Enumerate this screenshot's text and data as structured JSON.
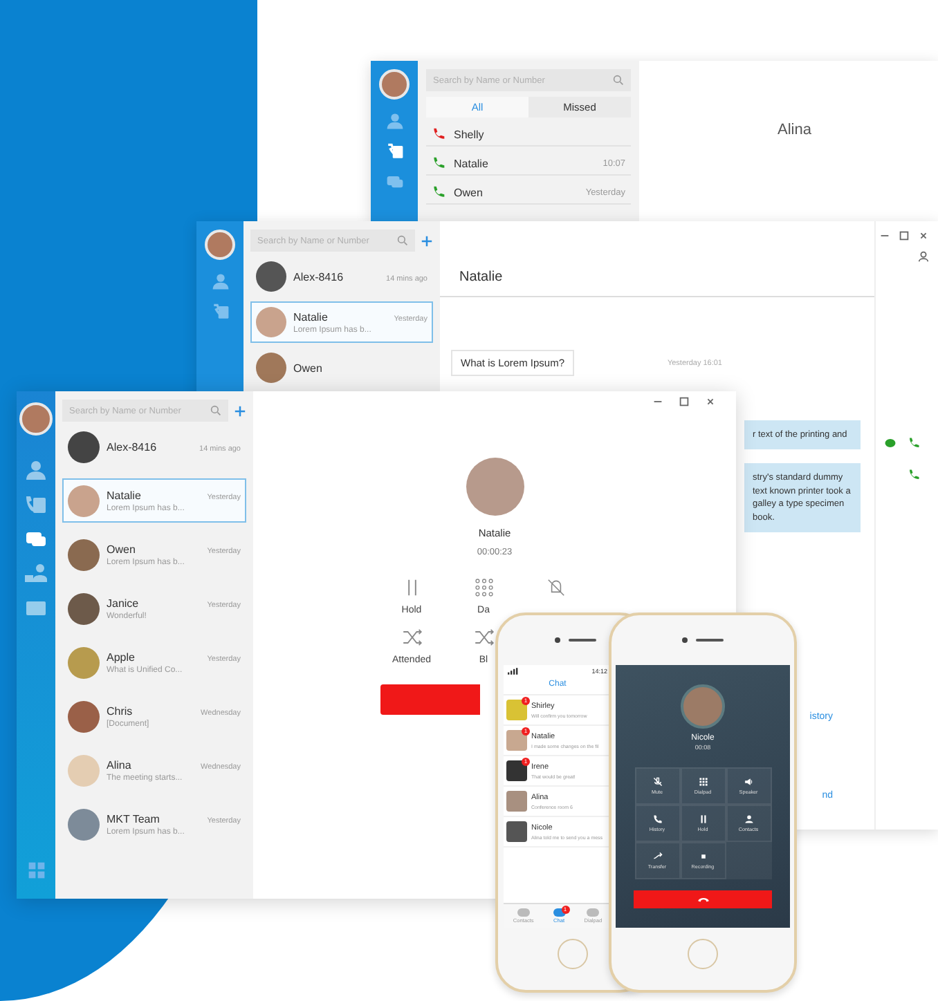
{
  "calls_window": {
    "title": "Alina",
    "search": {
      "placeholder": "Search by Name or Number"
    },
    "tabs": [
      {
        "label": "All",
        "selected": true
      },
      {
        "label": "Missed",
        "selected": false
      }
    ],
    "calls": [
      {
        "name": "Shelly",
        "missed": true
      },
      {
        "name": "Natalie",
        "time": "10:07",
        "missed": false
      },
      {
        "name": "Owen",
        "time": "Yesterday",
        "missed": false
      }
    ]
  },
  "chat_window": {
    "search": {
      "placeholder": "Search by Name or Number"
    },
    "contacts": [
      {
        "name": "Alex-8416",
        "time": "14 mins ago",
        "selected": false
      },
      {
        "name": "Natalie",
        "time": "Yesterday",
        "preview": "Lorem Ipsum has b...",
        "selected": true
      },
      {
        "name": "Owen",
        "selected": false
      }
    ],
    "chat_title": "Natalie",
    "received": "What is Lorem Ipsum?",
    "timestamp": "Yesterday 16:01",
    "sent": [
      "r text of the printing and",
      "stry's standard dummy text known printer took a galley a type specimen book."
    ],
    "links": [
      "istory",
      "nd"
    ]
  },
  "main_window": {
    "search": {
      "placeholder": "Search by Name or Number"
    },
    "nav": [
      {
        "kind": "contacts",
        "selected": false
      },
      {
        "kind": "calls",
        "selected": false
      },
      {
        "kind": "chat",
        "selected": true
      },
      {
        "kind": "conference",
        "selected": false
      },
      {
        "kind": "voicemail",
        "selected": false
      }
    ],
    "contacts": [
      {
        "name": "Alex-8416",
        "time": "14 mins ago",
        "selected": false
      },
      {
        "name": "Natalie",
        "time": "Yesterday",
        "preview": "Lorem Ipsum has b...",
        "selected": true
      },
      {
        "name": "Owen",
        "time": "Yesterday",
        "preview": "Lorem Ipsum has b...",
        "selected": false
      },
      {
        "name": "Janice",
        "time": "Yesterday",
        "preview": "Wonderful!",
        "selected": false
      },
      {
        "name": "Apple",
        "time": "Yesterday",
        "preview": "What is Unified Co...",
        "selected": false
      },
      {
        "name": "Chris",
        "time": "Wednesday",
        "preview": "[Document]",
        "selected": false
      },
      {
        "name": "Alina",
        "time": "Wednesday",
        "preview": "The meeting starts...",
        "selected": false
      },
      {
        "name": "MKT Team",
        "time": "Yesterday",
        "preview": "Lorem Ipsum has b...",
        "selected": false
      }
    ],
    "call": {
      "name": "Natalie",
      "duration": "00:00:23",
      "actions": [
        {
          "kind": "hold",
          "label": "Hold"
        },
        {
          "kind": "dialpad",
          "label": "Da"
        },
        {
          "kind": "mute"
        },
        {
          "kind": "transfer",
          "label": "Attended"
        },
        {
          "kind": "transfer",
          "label": "Bl"
        }
      ]
    }
  },
  "phone_chat": {
    "clock": "14:12",
    "title": "Chat",
    "chats": [
      {
        "name": "Shirley",
        "preview": "Will confirm you tomorrow",
        "badge": "1"
      },
      {
        "name": "Natalie",
        "preview": "I made some changes on the fil",
        "badge": "1"
      },
      {
        "name": "Irene",
        "preview": "That would be great!",
        "badge": "1"
      },
      {
        "name": "Alina",
        "preview": "Conference room 6"
      },
      {
        "name": "Nicole",
        "preview": "Alina told me to send you a mess"
      }
    ],
    "tabs": [
      {
        "label": "Contacts",
        "selected": false
      },
      {
        "label": "Chat",
        "selected": true,
        "badge": "1"
      },
      {
        "label": "Dialpad",
        "selected": false
      }
    ]
  },
  "phone_call": {
    "name": "Nicole",
    "duration": "00:08",
    "buttons": [
      {
        "kind": "mute",
        "label": "Mute"
      },
      {
        "kind": "dialpad",
        "label": "Dialpad"
      },
      {
        "kind": "speaker",
        "label": "Speaker"
      },
      {
        "kind": "history",
        "label": "History"
      },
      {
        "kind": "hold",
        "label": "Hold"
      },
      {
        "kind": "contacts",
        "label": "Contacts"
      },
      {
        "kind": "transfer",
        "label": "Transfer"
      },
      {
        "kind": "record",
        "label": "Recording"
      }
    ]
  }
}
